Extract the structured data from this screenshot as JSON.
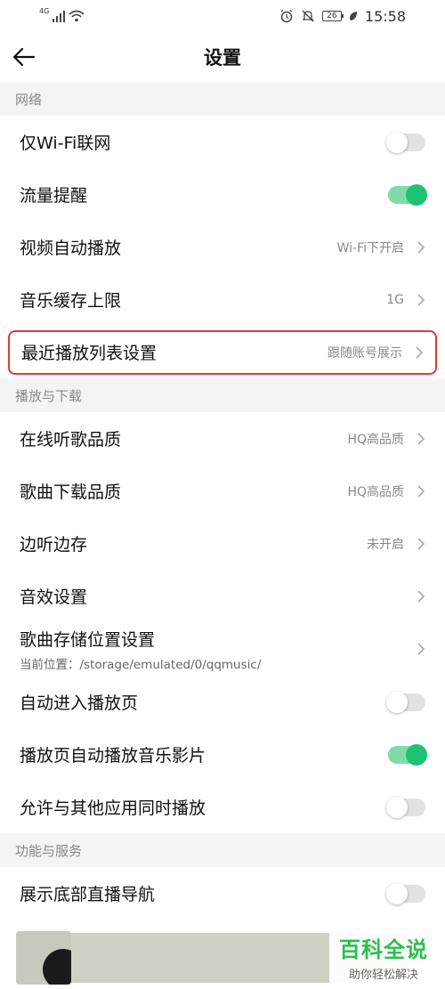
{
  "status_bar": {
    "network_label": "4G",
    "battery_level": "26",
    "time": "15:58"
  },
  "header": {
    "title": "设置"
  },
  "sections": {
    "network": {
      "title": "网络",
      "wifi_only": {
        "label": "仅Wi-Fi联网",
        "enabled": false
      },
      "data_reminder": {
        "label": "流量提醒",
        "enabled": true
      },
      "video_autoplay": {
        "label": "视频自动播放",
        "value": "Wi-Fi下开启"
      },
      "music_cache_limit": {
        "label": "音乐缓存上限",
        "value": "1G"
      },
      "recent_playlist": {
        "label": "最近播放列表设置",
        "value": "跟随账号展示"
      }
    },
    "playback": {
      "title": "播放与下载",
      "online_quality": {
        "label": "在线听歌品质",
        "value": "HQ高品质"
      },
      "download_quality": {
        "label": "歌曲下载品质",
        "value": "HQ高品质"
      },
      "listen_while_caching": {
        "label": "边听边存",
        "value": "未开启"
      },
      "sound_effects": {
        "label": "音效设置"
      },
      "storage_location": {
        "label": "歌曲存储位置设置",
        "sublabel": "当前位置：/storage/emulated/0/qqmusic/"
      },
      "auto_enter_player": {
        "label": "自动进入播放页",
        "enabled": false
      },
      "auto_play_mv": {
        "label": "播放页自动播放音乐影片",
        "enabled": true
      },
      "allow_concurrent": {
        "label": "允许与其他应用同时播放",
        "enabled": false
      }
    },
    "services": {
      "title": "功能与服务",
      "live_nav": {
        "label": "展示底部直播导航",
        "enabled": false
      }
    }
  },
  "watermark": {
    "title": "百科全说",
    "subtitle": "助你轻松解决"
  },
  "colors": {
    "toggle_on_knob": "#1fc274",
    "toggle_on_track": "#7fdcaa",
    "highlight_border": "#e03a3a",
    "section_bg": "#f4f4f4",
    "watermark_green": "#2bbf4e"
  }
}
